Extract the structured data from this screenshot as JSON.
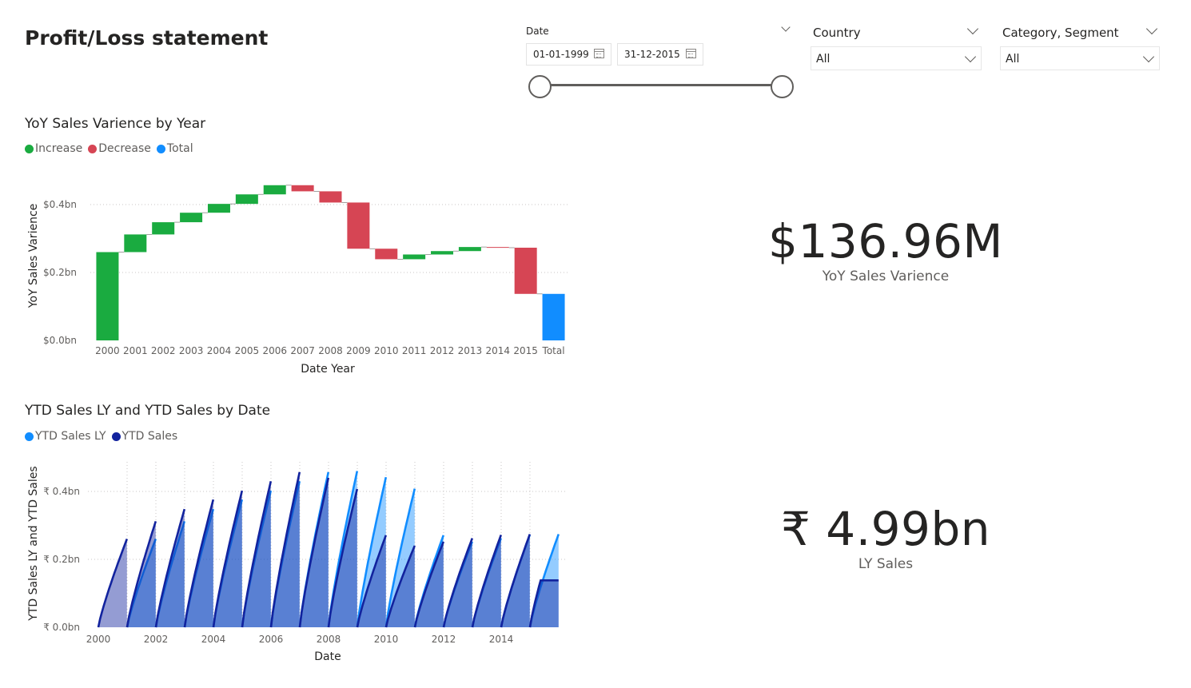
{
  "page": {
    "title": "Profit/Loss statement"
  },
  "filters": {
    "date": {
      "label": "Date",
      "start": "01-01-1999",
      "end": "31-12-2015",
      "range_start": 0,
      "range_end": 1
    },
    "country": {
      "label": "Country",
      "value": "All"
    },
    "category_segment": {
      "label": "Category, Segment",
      "value": "All"
    }
  },
  "yoy_chart": {
    "title": "YoY Sales Varience by Year",
    "legend": [
      {
        "label": "Increase",
        "color": "#1aab40"
      },
      {
        "label": "Decrease",
        "color": "#d64554"
      },
      {
        "label": "Total",
        "color": "#118dff"
      }
    ]
  },
  "ytd_chart": {
    "title": "YTD Sales LY and YTD Sales by Date",
    "legend": [
      {
        "label": "YTD Sales LY",
        "color": "#118dff"
      },
      {
        "label": "YTD Sales",
        "color": "#12239e"
      }
    ]
  },
  "kpis": {
    "yoy_variance": {
      "value": "$136.96M",
      "label": "YoY Sales Varience"
    },
    "ly_sales": {
      "value": "₹ 4.99bn",
      "label": "LY Sales"
    }
  },
  "chart_data": [
    {
      "type": "bar",
      "subtype": "waterfall",
      "xlabel": "Date Year",
      "ylabel": "YoY Sales Varience",
      "ylim": [
        0,
        0.5
      ],
      "yticks": [
        0,
        0.2,
        0.4
      ],
      "ytick_labels": [
        "$0.0bn",
        "$0.2bn",
        "$0.4bn"
      ],
      "grid": true,
      "categories": [
        "2000",
        "2001",
        "2002",
        "2003",
        "2004",
        "2005",
        "2006",
        "2007",
        "2008",
        "2009",
        "2010",
        "2011",
        "2012",
        "2013",
        "2014",
        "2015",
        "Total"
      ],
      "values": [
        0.26,
        0.052,
        0.036,
        0.028,
        0.026,
        0.028,
        0.027,
        -0.018,
        -0.033,
        -0.136,
        -0.031,
        0.014,
        0.01,
        0.012,
        -0.002,
        -0.136,
        0.137
      ],
      "colors": {
        "increase": "#1aab40",
        "decrease": "#d64554",
        "total": "#118dff"
      }
    },
    {
      "type": "area",
      "xlabel": "Date",
      "ylabel": "YTD Sales LY and YTD Sales",
      "ylim": [
        0,
        0.5
      ],
      "yticks": [
        0,
        0.2,
        0.4
      ],
      "ytick_labels": [
        "₹ 0.0bn",
        "₹ 0.2bn",
        "₹ 0.4bn"
      ],
      "xticks": [
        "2000",
        "2002",
        "2004",
        "2006",
        "2008",
        "2010",
        "2012",
        "2014"
      ],
      "xlim": [
        2000,
        2016
      ],
      "grid": true,
      "series": [
        {
          "name": "YTD Sales LY",
          "color": "#118dff",
          "years": [
            2001,
            2002,
            2003,
            2004,
            2005,
            2006,
            2007,
            2008,
            2009,
            2010,
            2011,
            2012,
            2013,
            2014,
            2015
          ],
          "year_end": [
            0.26,
            0.312,
            0.348,
            0.376,
            0.402,
            0.43,
            0.457,
            0.46,
            0.442,
            0.408,
            0.271,
            0.252,
            0.262,
            0.272,
            0.274
          ]
        },
        {
          "name": "YTD Sales",
          "color": "#12239e",
          "years": [
            2000,
            2001,
            2002,
            2003,
            2004,
            2005,
            2006,
            2007,
            2008,
            2009,
            2010,
            2011,
            2012,
            2013,
            2014,
            2015
          ],
          "year_end": [
            0.26,
            0.312,
            0.348,
            0.376,
            0.402,
            0.43,
            0.457,
            0.44,
            0.407,
            0.271,
            0.24,
            0.252,
            0.262,
            0.272,
            0.274,
            0.138
          ]
        }
      ]
    }
  ]
}
